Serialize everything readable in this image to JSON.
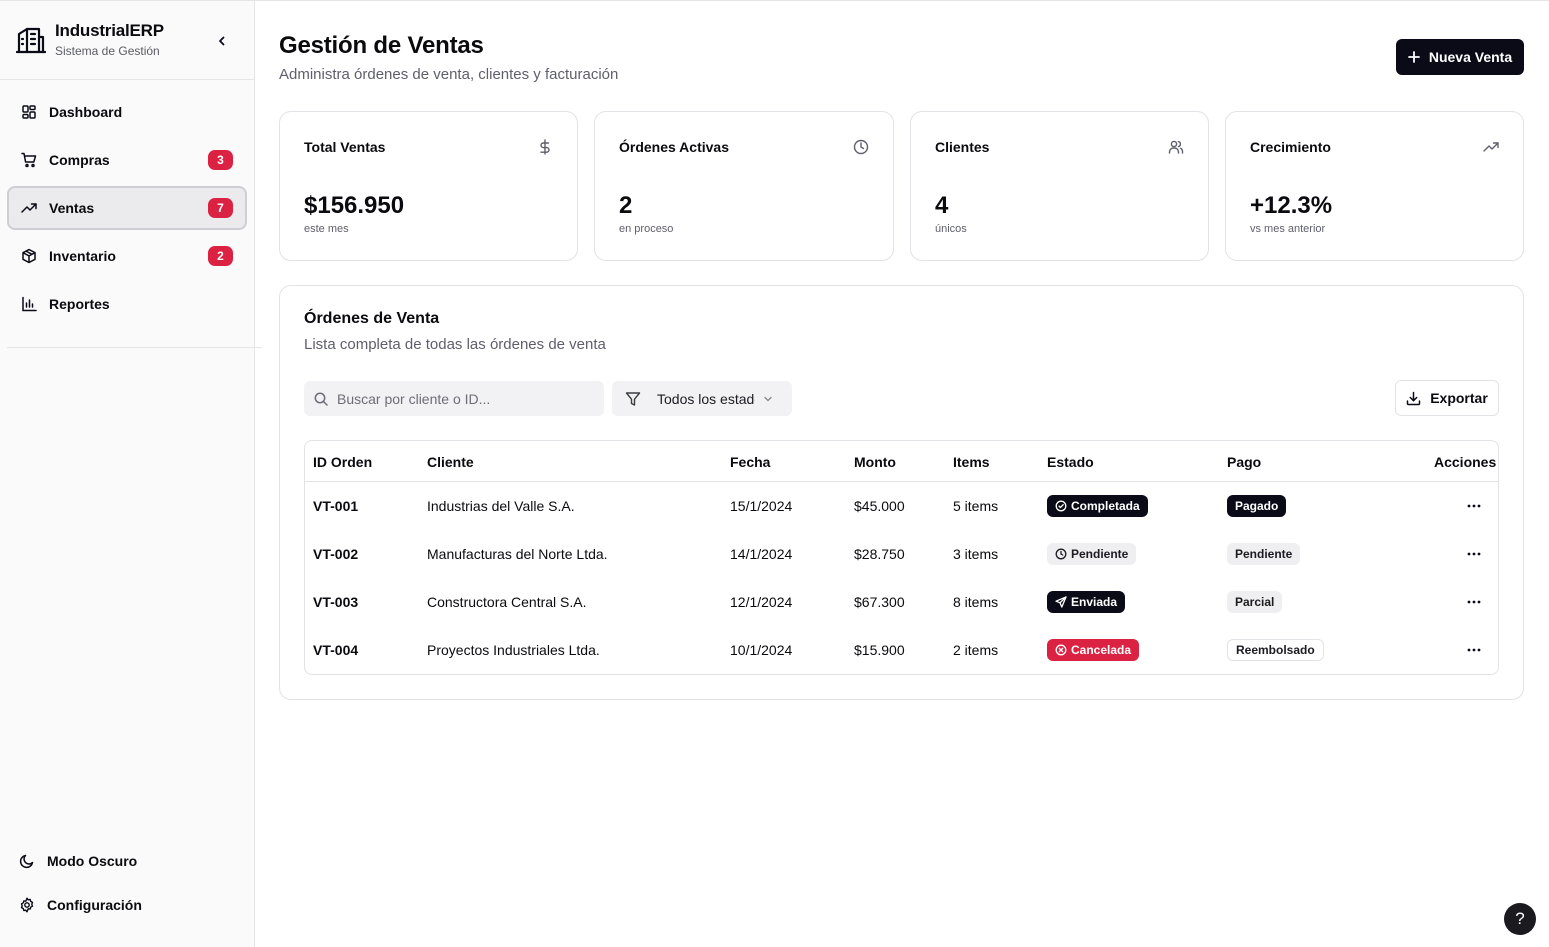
{
  "app": {
    "name": "IndustrialERP",
    "subtitle": "Sistema de Gestión",
    "logo_icon": "building-icon",
    "collapse_icon": "chevron-left-icon"
  },
  "sidebar": {
    "items": [
      {
        "label": "Dashboard",
        "icon": "layout-grid-icon",
        "badge": null,
        "active": false
      },
      {
        "label": "Compras",
        "icon": "shopping-cart-icon",
        "badge": "3",
        "active": false
      },
      {
        "label": "Ventas",
        "icon": "trending-up-icon",
        "badge": "7",
        "active": true
      },
      {
        "label": "Inventario",
        "icon": "package-icon",
        "badge": "2",
        "active": false
      },
      {
        "label": "Reportes",
        "icon": "bar-chart-icon",
        "badge": null,
        "active": false
      }
    ],
    "dark_mode_label": "Modo Oscuro",
    "settings_label": "Configuración"
  },
  "header": {
    "title": "Gestión de Ventas",
    "subtitle": "Administra órdenes de venta, clientes y facturación",
    "new_button": "Nueva Venta"
  },
  "stats": [
    {
      "title": "Total Ventas",
      "value": "$156.950",
      "note": "este mes",
      "icon": "dollar-icon"
    },
    {
      "title": "Órdenes Activas",
      "value": "2",
      "note": "en proceso",
      "icon": "clock-icon"
    },
    {
      "title": "Clientes",
      "value": "4",
      "note": "únicos",
      "icon": "users-icon"
    },
    {
      "title": "Crecimiento",
      "value": "+12.3%",
      "note": "vs mes anterior",
      "icon": "trending-up-icon"
    }
  ],
  "orders": {
    "title": "Órdenes de Venta",
    "subtitle": "Lista completa de todas las órdenes de venta",
    "search_placeholder": "Buscar por cliente o ID...",
    "filter_value": "Todos los estados",
    "export_label": "Exportar",
    "columns": [
      "ID Orden",
      "Cliente",
      "Fecha",
      "Monto",
      "Items",
      "Estado",
      "Pago",
      "Acciones"
    ],
    "rows": [
      {
        "id": "VT-001",
        "client": "Industrias del Valle S.A.",
        "date": "15/1/2024",
        "amount": "$45.000",
        "items": "5 items",
        "status": "Completada",
        "payment": "Pagado"
      },
      {
        "id": "VT-002",
        "client": "Manufacturas del Norte Ltda.",
        "date": "14/1/2024",
        "amount": "$28.750",
        "items": "3 items",
        "status": "Pendiente",
        "payment": "Pendiente"
      },
      {
        "id": "VT-003",
        "client": "Constructora Central S.A.",
        "date": "12/1/2024",
        "amount": "$67.300",
        "items": "8 items",
        "status": "Enviada",
        "payment": "Parcial"
      },
      {
        "id": "VT-004",
        "client": "Proyectos Industriales Ltda.",
        "date": "10/1/2024",
        "amount": "$15.900",
        "items": "2 items",
        "status": "Cancelada",
        "payment": "Reembolsado"
      }
    ]
  },
  "help_label": "?",
  "colors": {
    "primary": "#0b0b18",
    "badge_red": "#dc2242",
    "muted_text": "#5f5f6b",
    "border": "#e3e3e7"
  }
}
